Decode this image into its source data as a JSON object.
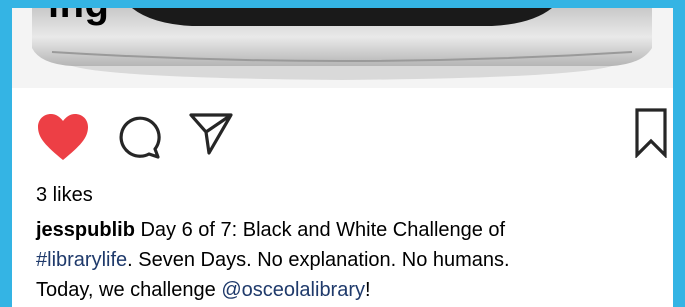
{
  "header": {
    "overlay_text": "ing"
  },
  "post": {
    "image_alt": "Black and white photo detail"
  },
  "actions": {
    "like_icon": "heart-icon",
    "comment_icon": "comment-icon",
    "share_icon": "paper-plane-icon",
    "save_icon": "bookmark-icon",
    "like_color": "#ed3f45"
  },
  "likes": {
    "label": "3 likes"
  },
  "caption": {
    "username": "jesspublib",
    "text_1": " Day 6 of 7: Black and White Challenge of",
    "hashtag": "#librarylife",
    "text_2": ". Seven Days. No explanation. No humans.",
    "text_3": "Today, we challenge ",
    "mention": "@osceolalibrary",
    "text_4": "!"
  },
  "colors": {
    "frame": "#34b4e4",
    "link": "#1f3a6b"
  }
}
